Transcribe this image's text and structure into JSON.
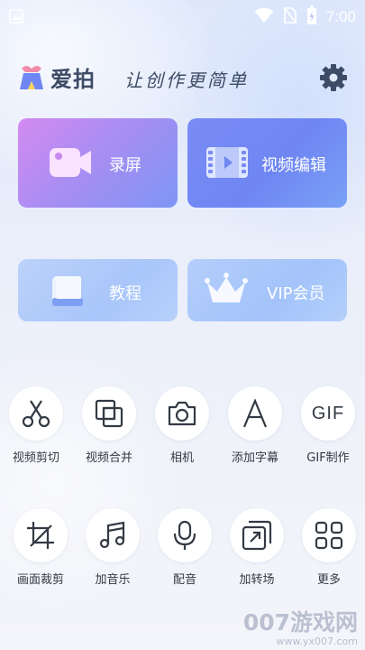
{
  "status_bar": {
    "time": "7:00"
  },
  "header": {
    "brand": "爱拍",
    "slogan": "让创作更简单"
  },
  "cards": {
    "record": "录屏",
    "video_edit": "视频编辑",
    "tutorial": "教程",
    "vip": "VIP会员"
  },
  "tools_row1": [
    {
      "label": "视频剪切",
      "icon": "scissors-icon"
    },
    {
      "label": "视频合并",
      "icon": "merge-icon"
    },
    {
      "label": "相机",
      "icon": "camera-icon"
    },
    {
      "label": "添加字幕",
      "icon": "text-a-icon"
    },
    {
      "label": "GIF制作",
      "icon": "gif-icon"
    }
  ],
  "tools_row2": [
    {
      "label": "画面裁剪",
      "icon": "crop-icon"
    },
    {
      "label": "加音乐",
      "icon": "music-note-icon"
    },
    {
      "label": "配音",
      "icon": "microphone-icon"
    },
    {
      "label": "加转场",
      "icon": "transition-icon"
    },
    {
      "label": "更多",
      "icon": "more-grid-icon"
    }
  ],
  "gif_glyph": "GIF",
  "watermark": {
    "main": "007游戏网",
    "url": "www.yx007.com"
  },
  "colors": {
    "record_card": "#b48cf2",
    "edit_card": "#7488f4",
    "text_dark": "#3d4b66"
  }
}
